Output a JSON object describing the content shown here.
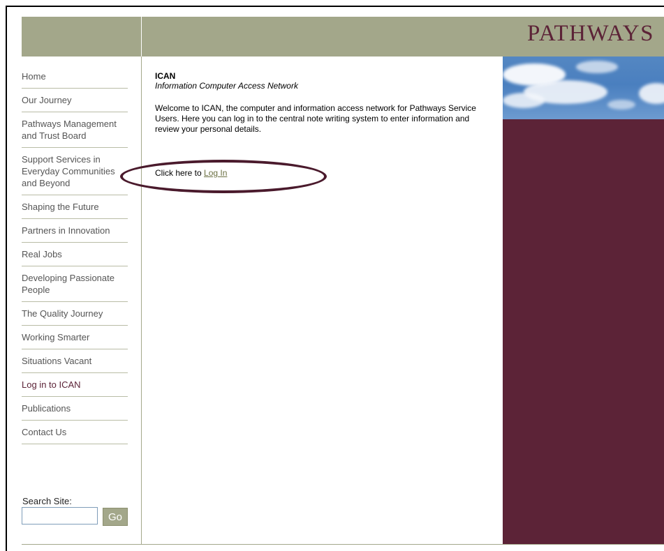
{
  "brand": "PATHWAYS",
  "sidebar": {
    "items": [
      {
        "label": "Home"
      },
      {
        "label": "Our Journey"
      },
      {
        "label": "Pathways Management and Trust Board"
      },
      {
        "label": "Support Services in Everyday Communities and Beyond"
      },
      {
        "label": "Shaping the Future"
      },
      {
        "label": "Partners in Innovation"
      },
      {
        "label": "Real Jobs"
      },
      {
        "label": "Developing Passionate People"
      },
      {
        "label": "The Quality Journey"
      },
      {
        "label": "Working Smarter"
      },
      {
        "label": "Situations Vacant"
      },
      {
        "label": "Log in to ICAN"
      },
      {
        "label": "Publications"
      },
      {
        "label": "Contact Us"
      }
    ],
    "search_label": "Search Site:",
    "search_value": "",
    "go_label": "Go"
  },
  "content": {
    "title": "ICAN",
    "subtitle": "Information Computer Access Network",
    "body": "Welcome to ICAN, the computer and information access network for Pathways Service Users. Here you can log in to the central note writing system to enter information and review your personal details.",
    "login_prefix": "Click here to ",
    "login_link": "Log In"
  },
  "colors": {
    "header": "#a3a78a",
    "brand": "#5c2337",
    "panel": "#5c2337",
    "link": "#6b7042"
  },
  "icons": [
    "sky-image",
    "annotation-ellipse"
  ]
}
